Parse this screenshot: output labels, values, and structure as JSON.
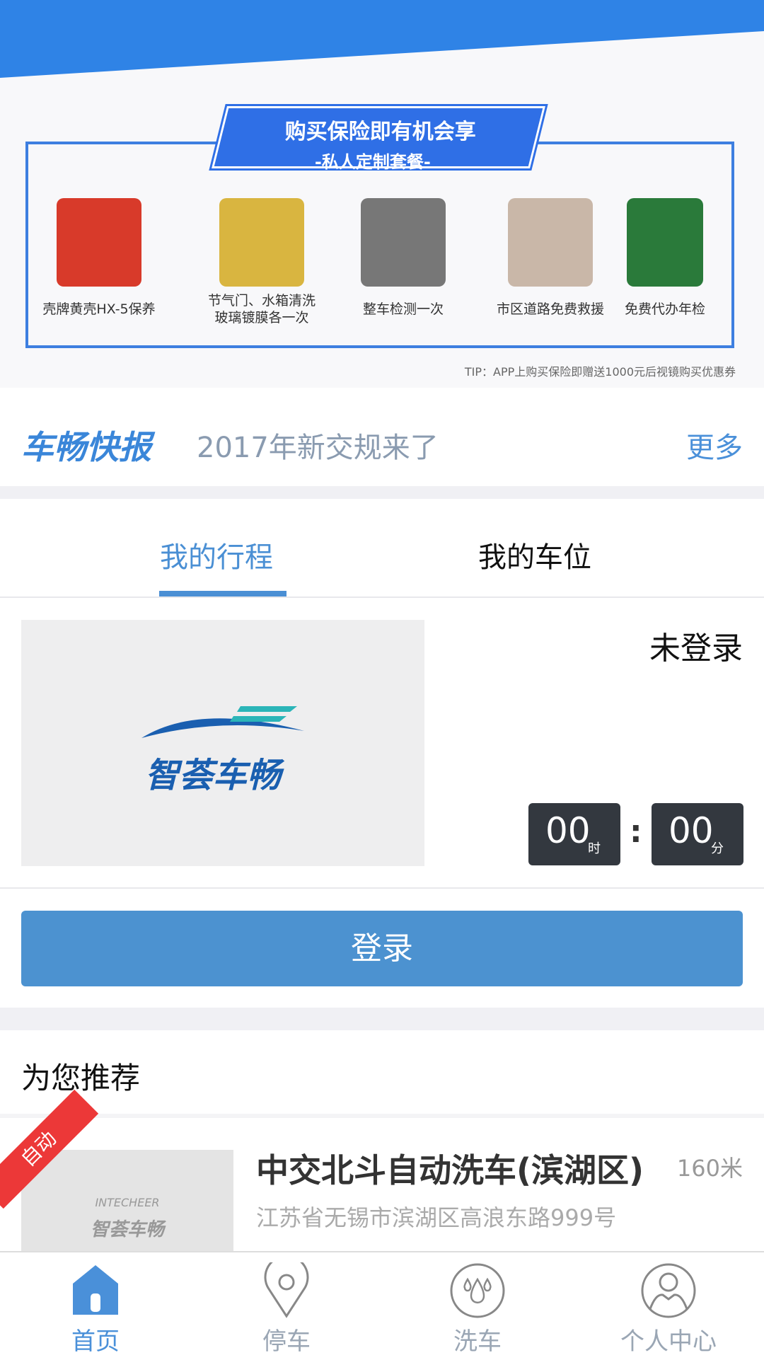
{
  "banner": {
    "title": "购买保险即有机会享",
    "subtitle": "-私人定制套餐-",
    "products": [
      {
        "label": "壳牌黄壳HX-5保养"
      },
      {
        "label": "节气门、水箱清洗\n玻璃镀膜各一次"
      },
      {
        "label": "整车检测一次"
      },
      {
        "label": "市区道路免费救援"
      },
      {
        "label": "免费代办年检"
      }
    ],
    "tip": "TIP：APP上购买保险即赠送1000元后视镜购买优惠券"
  },
  "news": {
    "logo": "车畅快报",
    "headline": "2017年新交规来了",
    "more": "更多"
  },
  "tabs": [
    {
      "label": "我的行程",
      "active": true
    },
    {
      "label": "我的车位",
      "active": false
    }
  ],
  "trip": {
    "logo_text": "智荟车畅",
    "status": "未登录",
    "hours": "00",
    "hours_unit": "时",
    "minutes": "00",
    "minutes_unit": "分",
    "colon": ":"
  },
  "login_label": "登录",
  "recommend": {
    "title": "为您推荐",
    "items": [
      {
        "badge": "自动",
        "name": "中交北斗自动洗车(滨湖区)",
        "distance": "160米",
        "address": "江苏省无锡市滨湖区高浪东路999号",
        "thumb_en": "INTECHEER",
        "thumb_cn": "智荟车畅"
      }
    ]
  },
  "nav": [
    {
      "label": "首页",
      "icon": "home-icon",
      "active": true
    },
    {
      "label": "停车",
      "icon": "location-pin-icon"
    },
    {
      "label": "洗车",
      "icon": "water-drops-icon"
    },
    {
      "label": "个人中心",
      "icon": "user-icon"
    }
  ],
  "colors": {
    "accent": "#4a90d9",
    "header": "#2f83e6",
    "badge": "#ec3838",
    "timer": "#33383f"
  }
}
